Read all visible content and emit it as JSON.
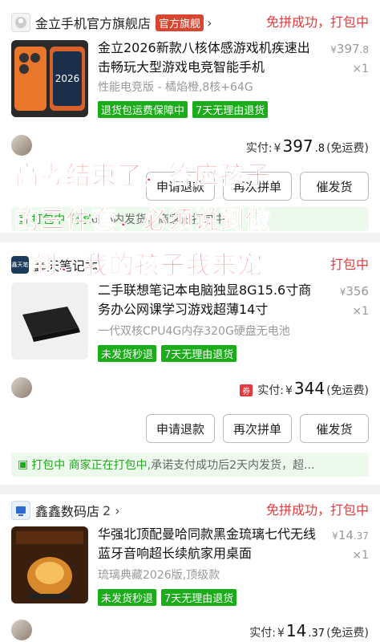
{
  "orders": [
    {
      "shop": {
        "name": "金立手机官方旗舰店",
        "flag": "官方旗舰"
      },
      "status": "免拼成功，打包中",
      "title": "金立2026新款八核体感游戏机疾速出击畅玩大型游戏电竞智能手机",
      "spec": "性能电竞版 - 橘焰橙,8核+64G",
      "tags": [
        "退货包运费保障中",
        "7天无理由退货"
      ],
      "unit_price": {
        "currency": "¥",
        "int": "397",
        "dec": ".8"
      },
      "qty": "×1",
      "paid": {
        "label": "实付:",
        "currency": "¥",
        "int": "397",
        "dec": ".8",
        "note": "(免运费)"
      },
      "buttons": [
        "申请退款",
        "再次拼单",
        "催发货"
      ],
      "notice": {
        "hl": "打包中 商家",
        "rest": "6 小内发货，商家正打包中"
      }
    },
    {
      "shop": {
        "name": "鑫天笔记本",
        "icon_text": "鑫天笔"
      },
      "status": "打包中",
      "title": "二手联想笔记本电脑独显8G15.6寸商务办公网课学习游戏超薄14寸",
      "spec": "一代双核CPU4G内存320G硬盘无电池",
      "tags": [
        "未发货秒退",
        "7天无理由退货"
      ],
      "unit_price": {
        "currency": "¥",
        "int": "356",
        "dec": ""
      },
      "qty": "×1",
      "paid": {
        "label": "实付:",
        "currency": "¥",
        "int": "344",
        "dec": "",
        "note": "(免运费)",
        "coupon": "券"
      },
      "buttons": [
        "申请退款",
        "再次拼单",
        "催发货"
      ],
      "notice": {
        "hl": "打包中 商家正在打包中,",
        "rest": "承诺支付成功后2天内发货，超..."
      }
    },
    {
      "shop": {
        "name": "鑫鑫数码店",
        "chev": "2 ›"
      },
      "status": "免拼成功，打包中",
      "title": "华强北顶配曼哈同款黑金琉璃七代无线蓝牙音响超长续航家用桌面",
      "spec": "琉璃典藏2026版,顶级款",
      "tags": [
        "未发货秒退",
        "7天无理由退货"
      ],
      "unit_price": {
        "currency": "¥",
        "int": "14",
        "dec": ".37"
      },
      "qty": "×1",
      "paid": {
        "label": "实付:",
        "currency": "¥",
        "int": "14",
        "dec": ".37",
        "note": "(免运费)"
      }
    }
  ],
  "overlay_lines": [
    "高考结束了，答应孩子",
    "的三件套，必须说到做",
    "到，我的孩子我来宠"
  ],
  "colors": {
    "accent": "#e4393c",
    "tag_green": "#1aad19",
    "overlay": "#e8262c"
  },
  "icons": {
    "shop1": "phone-shop-icon",
    "shop2": "laptop-shop-icon",
    "shop3": "digital-shop-icon"
  }
}
